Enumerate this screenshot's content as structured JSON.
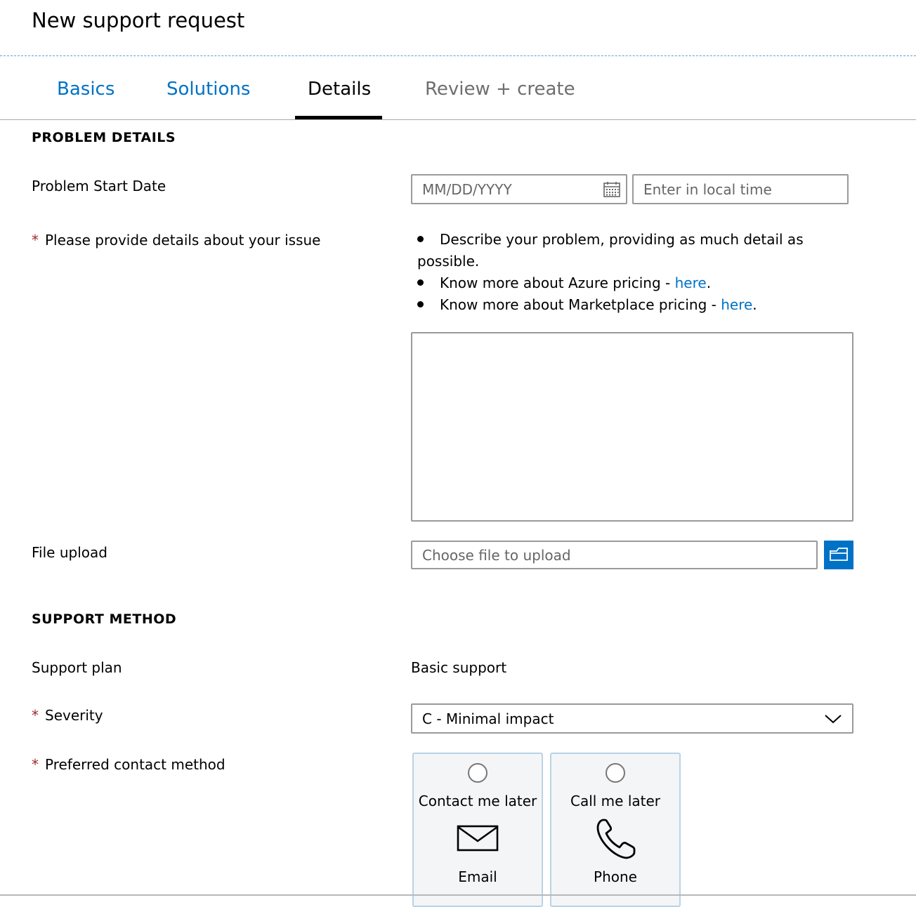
{
  "header": {
    "title": "New support request"
  },
  "tabs": [
    {
      "label": "Basics",
      "state": "completed"
    },
    {
      "label": "Solutions",
      "state": "completed"
    },
    {
      "label": "Details",
      "state": "active"
    },
    {
      "label": "Review + create",
      "state": "disabled"
    }
  ],
  "problem_details": {
    "section_title": "PROBLEM DETAILS",
    "start_date": {
      "label": "Problem Start Date",
      "date_placeholder": "MM/DD/YYYY",
      "date_icon": "calendar-icon",
      "time_placeholder": "Enter in local time"
    },
    "issue_details": {
      "required_marker": "*",
      "label": "Please provide details about your issue",
      "bullets": [
        {
          "text": "Describe your problem, providing as much detail as possible."
        },
        {
          "text": "Know more about Azure pricing - ",
          "link": "here",
          "suffix": "."
        },
        {
          "text": "Know more about Marketplace pricing - ",
          "link": "here",
          "suffix": "."
        }
      ],
      "value": ""
    },
    "file_upload": {
      "label": "File upload",
      "placeholder": "Choose file to upload",
      "button_icon": "folder-icon"
    }
  },
  "support_method": {
    "section_title": "SUPPORT METHOD",
    "support_plan": {
      "label": "Support plan",
      "value": "Basic support"
    },
    "severity": {
      "required_marker": "*",
      "label": "Severity",
      "selected": "C - Minimal impact",
      "icon": "chevron-down-icon"
    },
    "contact_method": {
      "required_marker": "*",
      "label": "Preferred contact method",
      "options": [
        {
          "title": "Contact me later",
          "caption": "Email",
          "icon": "envelope-icon",
          "selected": false
        },
        {
          "title": "Call me later",
          "caption": "Phone",
          "icon": "phone-icon",
          "selected": false
        }
      ]
    }
  },
  "colors": {
    "accent": "#0072c6",
    "required": "#a4262c",
    "card_border": "#b9d3e6",
    "card_background": "#f4f5f7"
  }
}
